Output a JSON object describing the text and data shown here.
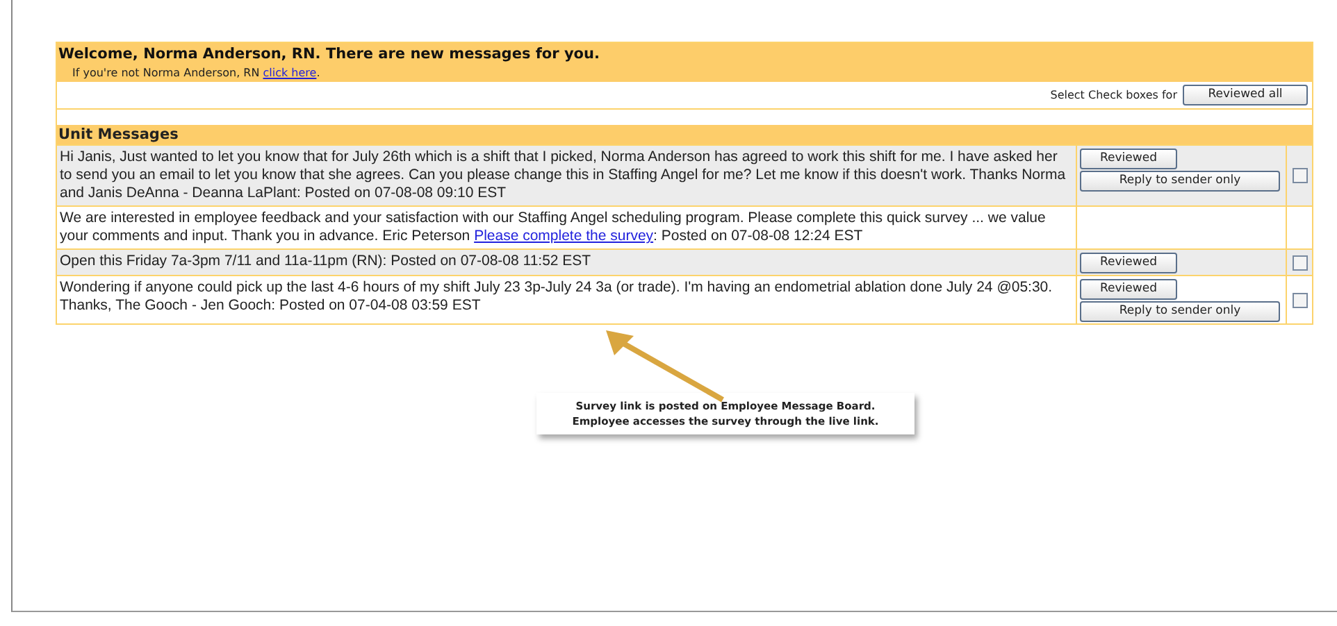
{
  "welcome": {
    "title": "Welcome, Norma Anderson, RN. There are new messages for you.",
    "subtitle": "If you're not Norma Anderson, RN ",
    "link": "click here",
    "after": "."
  },
  "toolbar": {
    "label": "Select Check boxes for",
    "button": "Reviewed all"
  },
  "section_title": "Unit Messages",
  "messages": [
    {
      "text": "Hi Janis, Just wanted to let you know that for July 26th which is a shift that I picked, Norma Anderson has agreed to work this shift for me. I have asked her to send you an email to let you know that she agrees. Can you please change this in Staffing Angel for me? Let me know if this doesn't work. Thanks Norma and Janis DeAnna - Deanna LaPlant: Posted on 07-08-08 09:10 EST",
      "buttons": [
        "Reviewed",
        "Reply to sender only"
      ],
      "checkbox": {
        "checked": false
      }
    },
    {
      "text": "We are interested in employee feedback and your satisfaction with our Staffing Angel scheduling program. Please complete this quick survey ... we value your comments and input. Thank you in advance. Eric Peterson ",
      "link": "Please complete the survey",
      "after": ": Posted on 07-08-08 12:24 EST"
    },
    {
      "text": "Open this Friday 7a-3pm 7/11 and 11a-11pm (RN): Posted on 07-08-08 11:52 EST",
      "buttons": [
        "Reviewed"
      ],
      "checkbox": {
        "checked": false
      }
    },
    {
      "text": "Wondering if anyone could pick up the last 4-6 hours of my shift July 23 3p-July 24 3a (or trade). I'm having an endometrial ablation done July 24 @05:30. Thanks, The Gooch - Jen Gooch: Posted on 07-04-08 03:59 EST",
      "buttons": [
        "Reviewed",
        "Reply to sender only"
      ],
      "checkbox": {
        "checked": false
      }
    }
  ],
  "callout": {
    "lines": [
      "Survey link is posted on Employee Message Board.",
      "Employee accesses the survey through the live link."
    ]
  }
}
